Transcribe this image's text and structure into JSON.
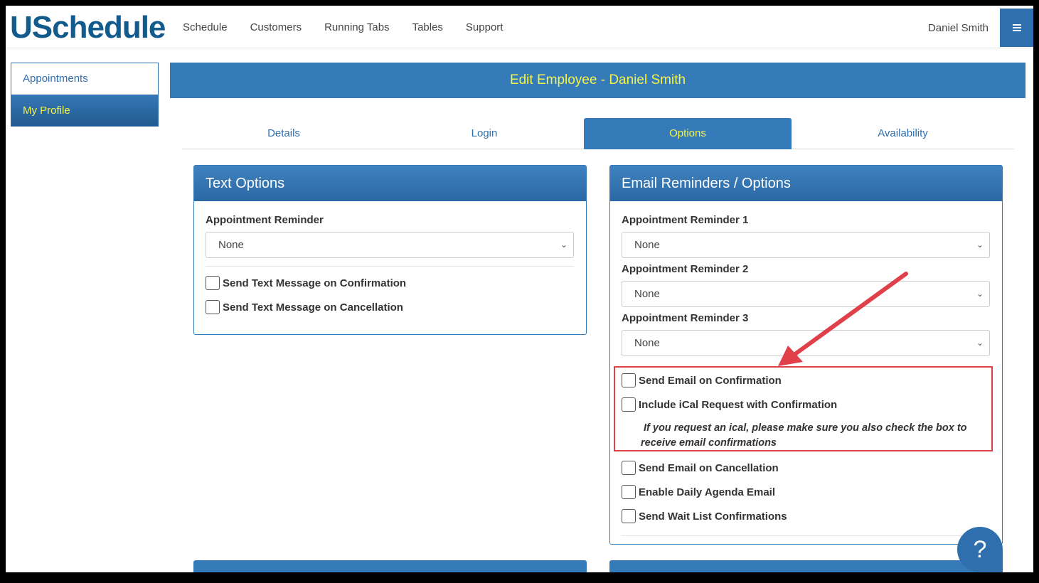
{
  "brand": {
    "logo": "USchedule"
  },
  "nav": {
    "items": [
      "Schedule",
      "Customers",
      "Running Tabs",
      "Tables",
      "Support"
    ],
    "user": "Daniel Smith",
    "menu_icon": "hamburger-icon"
  },
  "sidebar": {
    "items": [
      {
        "label": "Appointments"
      },
      {
        "label": "My Profile",
        "active": true
      }
    ]
  },
  "header": {
    "title": "Edit Employee - Daniel Smith"
  },
  "tabs": [
    {
      "label": "Details"
    },
    {
      "label": "Login"
    },
    {
      "label": "Options",
      "active": true
    },
    {
      "label": "Availability"
    }
  ],
  "text_options": {
    "title": "Text Options",
    "reminder_label": "Appointment Reminder",
    "reminder_value": "None",
    "checks": [
      {
        "label": "Send Text Message on Confirmation",
        "checked": false
      },
      {
        "label": "Send Text Message on Cancellation",
        "checked": false
      }
    ]
  },
  "email_options": {
    "title": "Email Reminders / Options",
    "reminders": [
      {
        "label": "Appointment Reminder 1",
        "value": "None"
      },
      {
        "label": "Appointment Reminder 2",
        "value": "None"
      },
      {
        "label": "Appointment Reminder 3",
        "value": "None"
      }
    ],
    "checks": [
      {
        "label": "Send Email on Confirmation",
        "checked": false
      },
      {
        "label": "Include iCal Request with Confirmation",
        "checked": false
      },
      {
        "label": "Send Email on Cancellation",
        "checked": false
      },
      {
        "label": "Enable Daily Agenda Email",
        "checked": false
      },
      {
        "label": "Send Wait List Confirmations",
        "checked": false
      }
    ],
    "note_line1": "If you request an ical, please make sure you also check the box to",
    "note_line2": "receive email confirmations"
  },
  "help": {
    "glyph": "?"
  },
  "colors": {
    "primary": "#357bba",
    "accent_text": "#f4f44a",
    "logo": "#135b8c",
    "annotation": "#e0404a"
  }
}
